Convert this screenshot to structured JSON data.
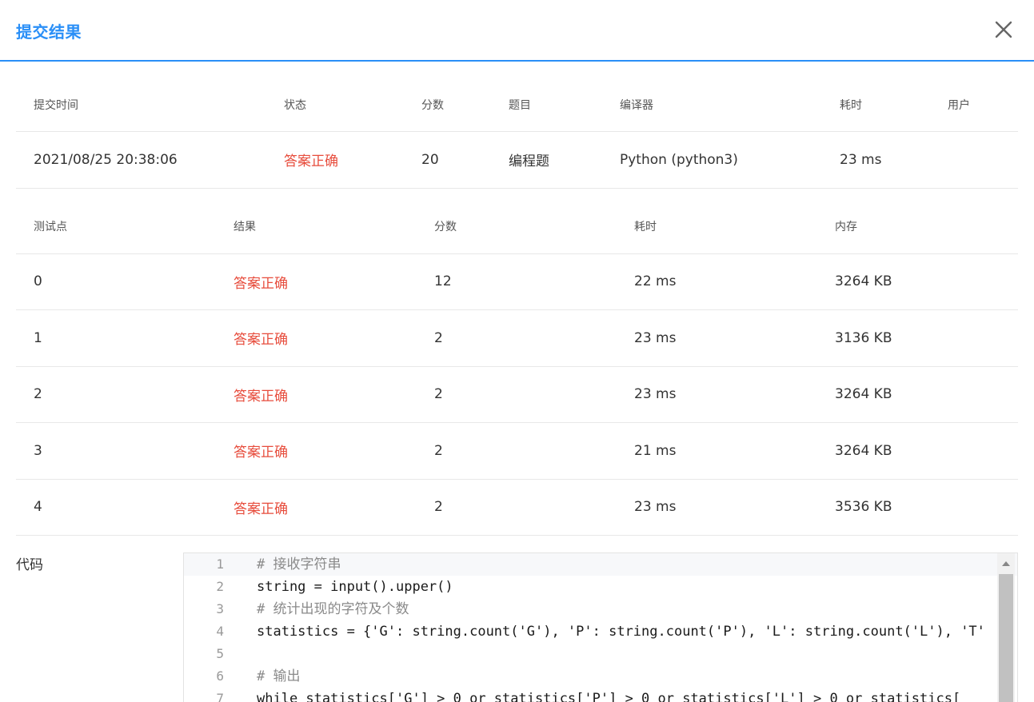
{
  "dialog": {
    "title": "提交结果"
  },
  "summary": {
    "headers": [
      "提交时间",
      "状态",
      "分数",
      "题目",
      "编译器",
      "耗时",
      "用户"
    ],
    "row": [
      "2021/08/25 20:38:06",
      "答案正确",
      "20",
      "编程题",
      "Python (python3)",
      "23 ms",
      ""
    ]
  },
  "tests": {
    "headers": [
      "测试点",
      "结果",
      "分数",
      "耗时",
      "内存"
    ],
    "rows": [
      [
        "0",
        "答案正确",
        "12",
        "22 ms",
        "3264 KB"
      ],
      [
        "1",
        "答案正确",
        "2",
        "23 ms",
        "3136 KB"
      ],
      [
        "2",
        "答案正确",
        "2",
        "23 ms",
        "3264 KB"
      ],
      [
        "3",
        "答案正确",
        "2",
        "21 ms",
        "3264 KB"
      ],
      [
        "4",
        "答案正确",
        "2",
        "23 ms",
        "3536 KB"
      ]
    ]
  },
  "code": {
    "label": "代码",
    "lines": [
      "# 接收字符串",
      "string = input().upper()",
      "# 统计出现的字符及个数",
      "statistics = {'G': string.count('G'), 'P': string.count('P'), 'L': string.count('L'), 'T'",
      "",
      "# 输出",
      "while statistics['G'] > 0 or statistics['P'] > 0 or statistics['L'] > 0 or statistics["
    ]
  },
  "colors": {
    "accent": "#2a8ff7",
    "status_ok": "#e74c3c"
  }
}
